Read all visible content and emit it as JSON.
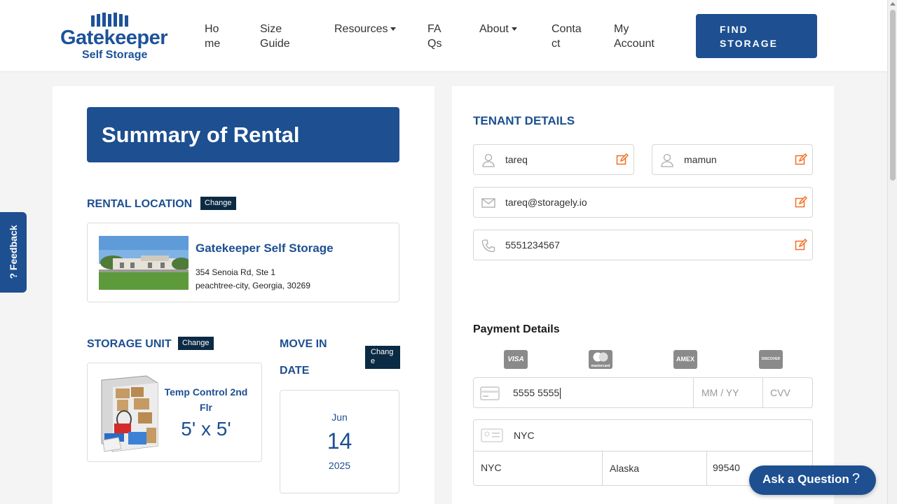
{
  "brand": {
    "name": "Gatekeeper",
    "sub": "Self Storage"
  },
  "nav": {
    "home": [
      "Ho",
      "me"
    ],
    "size_guide": [
      "Size",
      "Guide"
    ],
    "resources": "Resources",
    "faqs": [
      "FA",
      "Qs"
    ],
    "about": "About",
    "contact": [
      "Conta",
      "ct"
    ],
    "my_account": [
      "My",
      "Account"
    ],
    "find_storage": [
      "FIND",
      "STORAGE"
    ]
  },
  "feedback": {
    "label": "? Feedback"
  },
  "summary": {
    "title": "Summary of Rental",
    "rental_location_label": "RENTAL LOCATION",
    "change_label": "Change",
    "location": {
      "name": "Gatekeeper Self Storage",
      "address1": "354 Senoia Rd, Ste 1",
      "address2": "peachtree-city, Georgia, 30269"
    },
    "storage_unit_label": "STORAGE UNIT",
    "unit": {
      "name": "Temp Control 2nd Flr",
      "size": "5' x 5'"
    },
    "move_in_label": [
      "MOVE IN",
      "DATE"
    ],
    "move_change_label": [
      "Chang",
      "e"
    ],
    "move_in": {
      "month": "Jun",
      "day": "14",
      "year": "2025"
    }
  },
  "tenant": {
    "title": "TENANT DETAILS",
    "first_name": "tareq",
    "last_name": "mamun",
    "email": "tareq@storagely.io",
    "phone": "5551234567"
  },
  "payment": {
    "title": "Payment Details",
    "card_brands": [
      "VISA",
      "mastercard",
      "AMEX",
      "DISCOVER"
    ],
    "card_number": "5555 5555",
    "expiry_placeholder": "MM / YY",
    "cvv_placeholder": "CVV",
    "name_on_card": "NYC",
    "city": "NYC",
    "state": "Alaska",
    "zip": "99540"
  },
  "chat": {
    "label": "Ask a Question",
    "icon": "?"
  },
  "colors": {
    "brand_blue": "#1d4f91",
    "badge_dark": "#0b2a43",
    "edit_orange": "#f26f21"
  }
}
